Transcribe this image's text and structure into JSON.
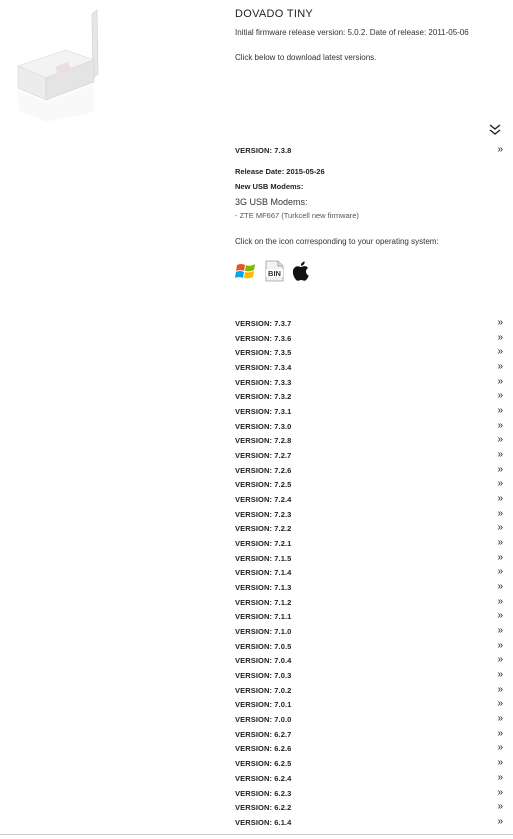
{
  "product": {
    "title": "DOVADO TINY",
    "intro": "Initial firmware release version: 5.0.2. Date of release: 2011-05-06",
    "click_below": "Click below to download latest versions."
  },
  "expanded_version": {
    "label": "VERSION: 7.3.8",
    "release_date": "Release Date: 2015-05-26",
    "new_modems_heading": "New USB Modems:",
    "modem_type": "3G USB Modems:",
    "modem_item": "- ZTE MF667 (Turkcell new firmware)",
    "os_prompt": "Click on the icon corresponding to your operating system:",
    "os_icons": [
      "windows-icon",
      "bin-icon",
      "apple-icon"
    ]
  },
  "icons": {
    "collapse_all": "double-chevron-down-icon",
    "row_chevron": "double-chevron-right-icon",
    "row_chevron_glyph": "»"
  },
  "versions": [
    "VERSION: 7.3.7",
    "VERSION: 7.3.6",
    "VERSION: 7.3.5",
    "VERSION: 7.3.4",
    "VERSION: 7.3.3",
    "VERSION: 7.3.2",
    "VERSION: 7.3.1",
    "VERSION: 7.3.0",
    "VERSION: 7.2.8",
    "VERSION: 7.2.7",
    "VERSION: 7.2.6",
    "VERSION: 7.2.5",
    "VERSION: 7.2.4",
    "VERSION: 7.2.3",
    "VERSION: 7.2.2",
    "VERSION: 7.2.1",
    "VERSION: 7.1.5",
    "VERSION: 7.1.4",
    "VERSION: 7.1.3",
    "VERSION: 7.1.2",
    "VERSION: 7.1.1",
    "VERSION: 7.1.0",
    "VERSION: 7.0.5",
    "VERSION: 7.0.4",
    "VERSION: 7.0.3",
    "VERSION: 7.0.2",
    "VERSION: 7.0.1",
    "VERSION: 7.0.0",
    "VERSION: 6.2.7",
    "VERSION: 6.2.6",
    "VERSION: 6.2.5",
    "VERSION: 6.2.4",
    "VERSION: 6.2.3",
    "VERSION: 6.2.2",
    "VERSION: 6.1.4"
  ]
}
